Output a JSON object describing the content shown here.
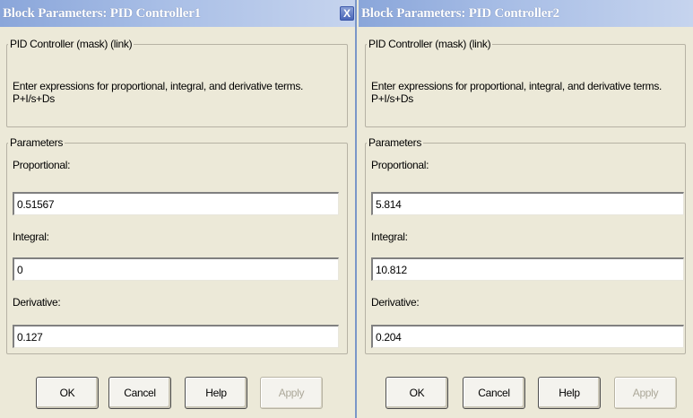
{
  "dialogs": [
    {
      "title": "Block Parameters: PID Controller1",
      "close_glyph": "X",
      "mask_group_label": "PID Controller (mask) (link)",
      "description_line1": "Enter expressions for proportional, integral, and derivative terms.",
      "description_line2": "P+I/s+Ds",
      "params_group_label": "Parameters",
      "proportional_label": "Proportional:",
      "proportional_value": "0.51567",
      "integral_label": "Integral:",
      "integral_value": "0",
      "derivative_label": "Derivative:",
      "derivative_value": "0.127",
      "ok_label": "OK",
      "cancel_label": "Cancel",
      "help_label": "Help",
      "apply_label": "Apply"
    },
    {
      "title": "Block Parameters: PID Controller2",
      "mask_group_label": "PID Controller (mask) (link)",
      "description_line1": "Enter expressions for proportional, integral, and derivative terms.",
      "description_line2": "P+I/s+Ds",
      "params_group_label": "Parameters",
      "proportional_label": "Proportional:",
      "proportional_value": "5.814",
      "integral_label": "Integral:",
      "integral_value": "10.812",
      "derivative_label": "Derivative:",
      "derivative_value": "0.204",
      "ok_label": "OK",
      "cancel_label": "Cancel",
      "help_label": "Help",
      "apply_label": "Apply"
    }
  ],
  "icons": {
    "close": "close-icon"
  },
  "colors": {
    "dialog_bg": "#ece9d8",
    "titlebar_start": "#8aa6da",
    "titlebar_end": "#c6d4ee",
    "disabled_text": "#aca899"
  }
}
